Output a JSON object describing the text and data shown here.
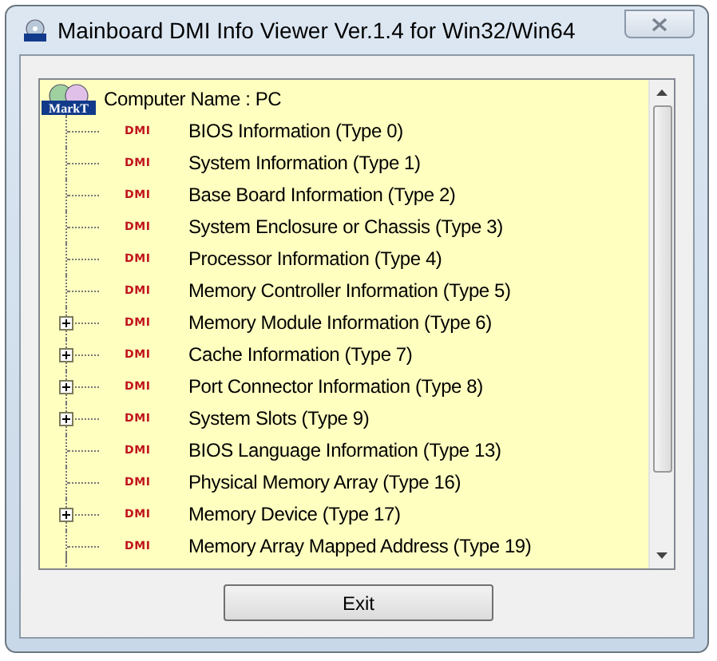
{
  "window": {
    "title": "Mainboard DMI Info Viewer Ver.1.4 for Win32/Win64"
  },
  "tree": {
    "root": {
      "label": "Computer Name : PC",
      "logo_text": "MarkT"
    },
    "items": [
      {
        "label": "BIOS Information (Type 0)",
        "badge": "DMI",
        "kind": "leaf"
      },
      {
        "label": "System Information (Type 1)",
        "badge": "DMI",
        "kind": "leaf"
      },
      {
        "label": "Base Board Information (Type 2)",
        "badge": "DMI",
        "kind": "leaf"
      },
      {
        "label": "System Enclosure or Chassis (Type 3)",
        "badge": "DMI",
        "kind": "leaf"
      },
      {
        "label": "Processor Information (Type 4)",
        "badge": "DMI",
        "kind": "leaf"
      },
      {
        "label": "Memory Controller Information (Type 5)",
        "badge": "DMI",
        "kind": "leaf"
      },
      {
        "label": "Memory Module Information (Type 6)",
        "badge": "DMI",
        "kind": "node"
      },
      {
        "label": "Cache Information (Type 7)",
        "badge": "DMI",
        "kind": "node"
      },
      {
        "label": "Port Connector Information (Type 8)",
        "badge": "DMI",
        "kind": "node"
      },
      {
        "label": "System Slots (Type 9)",
        "badge": "DMI",
        "kind": "node"
      },
      {
        "label": "BIOS Language Information (Type 13)",
        "badge": "DMI",
        "kind": "leaf"
      },
      {
        "label": "Physical Memory Array (Type 16)",
        "badge": "DMI",
        "kind": "leaf"
      },
      {
        "label": "Memory Device (Type 17)",
        "badge": "DMI",
        "kind": "node"
      },
      {
        "label": "Memory Array Mapped Address (Type 19)",
        "badge": "DMI",
        "kind": "leaf"
      }
    ]
  },
  "buttons": [
    {
      "label": "Exit"
    }
  ]
}
